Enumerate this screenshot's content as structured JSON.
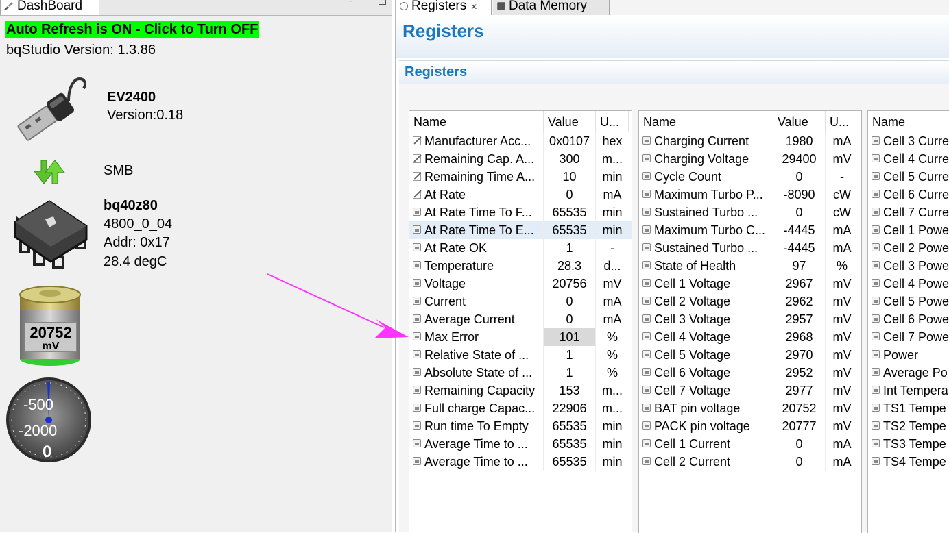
{
  "dashboard": {
    "tab_label": "DashBoard",
    "refresh_label": "Auto Refresh is ON - Click to Turn OFF",
    "version_label": "bqStudio Version:  1.3.86",
    "adapter": {
      "name": "EV2400",
      "version": "Version:0.18",
      "icon": "usb-plug-icon"
    },
    "bus": {
      "label": "SMB",
      "icon": "up-down-arrows-icon"
    },
    "device": {
      "name": "bq40z80",
      "firmware": "4800_0_04",
      "address": "Addr: 0x17",
      "temperature": "28.4 degC",
      "icon": "chip-icon"
    },
    "battery": {
      "value": "20752",
      "unit": "mV",
      "icon": "battery-icon"
    },
    "gauge": {
      "label_top": "-500",
      "label_mid": "-2000",
      "label_bottom": "0",
      "icon": "current-gauge-icon"
    },
    "colors": {
      "refresh_bg": "#00ff00"
    }
  },
  "registers": {
    "tabs": [
      {
        "label": "Registers"
      },
      {
        "label": "Data Memory"
      }
    ],
    "title": "Registers",
    "section_title": "Registers",
    "colors": {
      "title": "#1a78c2"
    },
    "column_headers": {
      "name": "Name",
      "value": "Value",
      "unit": "U..."
    },
    "columns": [
      {
        "rows": [
          {
            "name": "Manufacturer Acc...",
            "value": "0x0107",
            "unit": "hex",
            "icon": "edit-icon"
          },
          {
            "name": "Remaining Cap. A...",
            "value": "300",
            "unit": "m...",
            "icon": "edit-icon"
          },
          {
            "name": "Remaining Time A...",
            "value": "10",
            "unit": "min",
            "icon": "edit-icon"
          },
          {
            "name": "At Rate",
            "value": "0",
            "unit": "mA",
            "icon": "edit-icon"
          },
          {
            "name": "At Rate Time To F...",
            "value": "65535",
            "unit": "min",
            "icon": "lock-icon"
          },
          {
            "name": "At Rate Time To E...",
            "value": "65535",
            "unit": "min",
            "icon": "lock-icon",
            "selected": true
          },
          {
            "name": "At Rate OK",
            "value": "1",
            "unit": "-",
            "icon": "lock-icon"
          },
          {
            "name": "Temperature",
            "value": "28.3",
            "unit": "d...",
            "icon": "lock-icon"
          },
          {
            "name": "Voltage",
            "value": "20756",
            "unit": "mV",
            "icon": "lock-icon"
          },
          {
            "name": "Current",
            "value": "0",
            "unit": "mA",
            "icon": "lock-icon"
          },
          {
            "name": "Average Current",
            "value": "0",
            "unit": "mA",
            "icon": "lock-icon"
          },
          {
            "name": "Max Error",
            "value": "101",
            "unit": "%",
            "icon": "lock-icon",
            "value_highlight": true
          },
          {
            "name": "Relative State of ...",
            "value": "1",
            "unit": "%",
            "icon": "lock-icon"
          },
          {
            "name": "Absolute State of ...",
            "value": "1",
            "unit": "%",
            "icon": "lock-icon"
          },
          {
            "name": "Remaining Capacity",
            "value": "153",
            "unit": "m...",
            "icon": "lock-icon"
          },
          {
            "name": "Full charge Capac...",
            "value": "22906",
            "unit": "m...",
            "icon": "lock-icon"
          },
          {
            "name": "Run time To Empty",
            "value": "65535",
            "unit": "min",
            "icon": "lock-icon"
          },
          {
            "name": "Average Time to ...",
            "value": "65535",
            "unit": "min",
            "icon": "lock-icon"
          },
          {
            "name": "Average Time to ...",
            "value": "65535",
            "unit": "min",
            "icon": "lock-icon"
          }
        ]
      },
      {
        "rows": [
          {
            "name": "Charging Current",
            "value": "1980",
            "unit": "mA",
            "icon": "lock-icon"
          },
          {
            "name": "Charging Voltage",
            "value": "29400",
            "unit": "mV",
            "icon": "lock-icon"
          },
          {
            "name": "Cycle Count",
            "value": "0",
            "unit": "-",
            "icon": "lock-icon"
          },
          {
            "name": "Maximum Turbo P...",
            "value": "-8090",
            "unit": "cW",
            "icon": "lock-icon"
          },
          {
            "name": "Sustained Turbo ...",
            "value": "0",
            "unit": "cW",
            "icon": "lock-icon"
          },
          {
            "name": "Maximum Turbo C...",
            "value": "-4445",
            "unit": "mA",
            "icon": "lock-icon"
          },
          {
            "name": "Sustained Turbo ...",
            "value": "-4445",
            "unit": "mA",
            "icon": "lock-icon"
          },
          {
            "name": "State of Health",
            "value": "97",
            "unit": "%",
            "icon": "lock-icon"
          },
          {
            "name": "Cell 1 Voltage",
            "value": "2967",
            "unit": "mV",
            "icon": "lock-icon"
          },
          {
            "name": "Cell 2 Voltage",
            "value": "2962",
            "unit": "mV",
            "icon": "lock-icon"
          },
          {
            "name": "Cell 3 Voltage",
            "value": "2957",
            "unit": "mV",
            "icon": "lock-icon"
          },
          {
            "name": "Cell 4 Voltage",
            "value": "2968",
            "unit": "mV",
            "icon": "lock-icon"
          },
          {
            "name": "Cell 5 Voltage",
            "value": "2970",
            "unit": "mV",
            "icon": "lock-icon"
          },
          {
            "name": "Cell 6 Voltage",
            "value": "2952",
            "unit": "mV",
            "icon": "lock-icon"
          },
          {
            "name": "Cell 7 Voltage",
            "value": "2977",
            "unit": "mV",
            "icon": "lock-icon"
          },
          {
            "name": "BAT pin voltage",
            "value": "20752",
            "unit": "mV",
            "icon": "lock-icon"
          },
          {
            "name": "PACK pin voltage",
            "value": "20777",
            "unit": "mV",
            "icon": "lock-icon"
          },
          {
            "name": "Cell 1 Current",
            "value": "0",
            "unit": "mA",
            "icon": "lock-icon"
          },
          {
            "name": "Cell 2 Current",
            "value": "0",
            "unit": "mA",
            "icon": "lock-icon"
          }
        ]
      },
      {
        "rows": [
          {
            "name": "Cell 3 Curre",
            "value": "",
            "unit": "",
            "icon": "lock-icon"
          },
          {
            "name": "Cell 4 Curre",
            "value": "",
            "unit": "",
            "icon": "lock-icon"
          },
          {
            "name": "Cell 5 Curre",
            "value": "",
            "unit": "",
            "icon": "lock-icon"
          },
          {
            "name": "Cell 6 Curre",
            "value": "",
            "unit": "",
            "icon": "lock-icon"
          },
          {
            "name": "Cell 7 Curre",
            "value": "",
            "unit": "",
            "icon": "lock-icon"
          },
          {
            "name": "Cell 1 Powe",
            "value": "",
            "unit": "",
            "icon": "lock-icon"
          },
          {
            "name": "Cell 2 Powe",
            "value": "",
            "unit": "",
            "icon": "lock-icon"
          },
          {
            "name": "Cell 3 Powe",
            "value": "",
            "unit": "",
            "icon": "lock-icon"
          },
          {
            "name": "Cell 4 Powe",
            "value": "",
            "unit": "",
            "icon": "lock-icon"
          },
          {
            "name": "Cell 5 Powe",
            "value": "",
            "unit": "",
            "icon": "lock-icon"
          },
          {
            "name": "Cell 6 Powe",
            "value": "",
            "unit": "",
            "icon": "lock-icon"
          },
          {
            "name": "Cell 7 Powe",
            "value": "",
            "unit": "",
            "icon": "lock-icon"
          },
          {
            "name": "Power",
            "value": "",
            "unit": "",
            "icon": "lock-icon"
          },
          {
            "name": "Average Po",
            "value": "",
            "unit": "",
            "icon": "lock-icon"
          },
          {
            "name": "Int Tempera",
            "value": "",
            "unit": "",
            "icon": "lock-icon"
          },
          {
            "name": "TS1 Tempe",
            "value": "",
            "unit": "",
            "icon": "lock-icon"
          },
          {
            "name": "TS2 Tempe",
            "value": "",
            "unit": "",
            "icon": "lock-icon"
          },
          {
            "name": "TS3 Tempe",
            "value": "",
            "unit": "",
            "icon": "lock-icon"
          },
          {
            "name": "TS4 Tempe",
            "value": "",
            "unit": "",
            "icon": "lock-icon"
          }
        ]
      }
    ]
  },
  "annotation": {
    "icon": "magenta-arrow-icon",
    "color": "#ff33ff"
  }
}
